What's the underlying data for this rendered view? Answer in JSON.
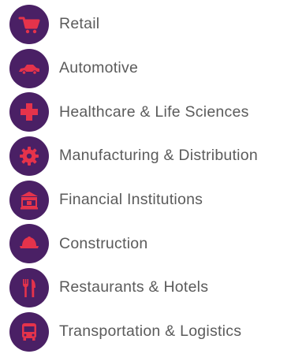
{
  "colors": {
    "badge_bg": "#4a2065",
    "icon_fill": "#e5334b",
    "label_text": "#5b5b5b"
  },
  "industries": [
    {
      "label": "Retail",
      "icon": "shopping-cart-icon"
    },
    {
      "label": "Automotive",
      "icon": "car-icon"
    },
    {
      "label": "Healthcare & Life Sciences",
      "icon": "medical-cross-icon"
    },
    {
      "label": "Manufacturing & Distribution",
      "icon": "gear-icon"
    },
    {
      "label": "Financial Institutions",
      "icon": "bank-icon"
    },
    {
      "label": "Construction",
      "icon": "hard-hat-icon"
    },
    {
      "label": "Restaurants & Hotels",
      "icon": "fork-knife-icon"
    },
    {
      "label": "Transportation & Logistics",
      "icon": "bus-icon"
    }
  ]
}
